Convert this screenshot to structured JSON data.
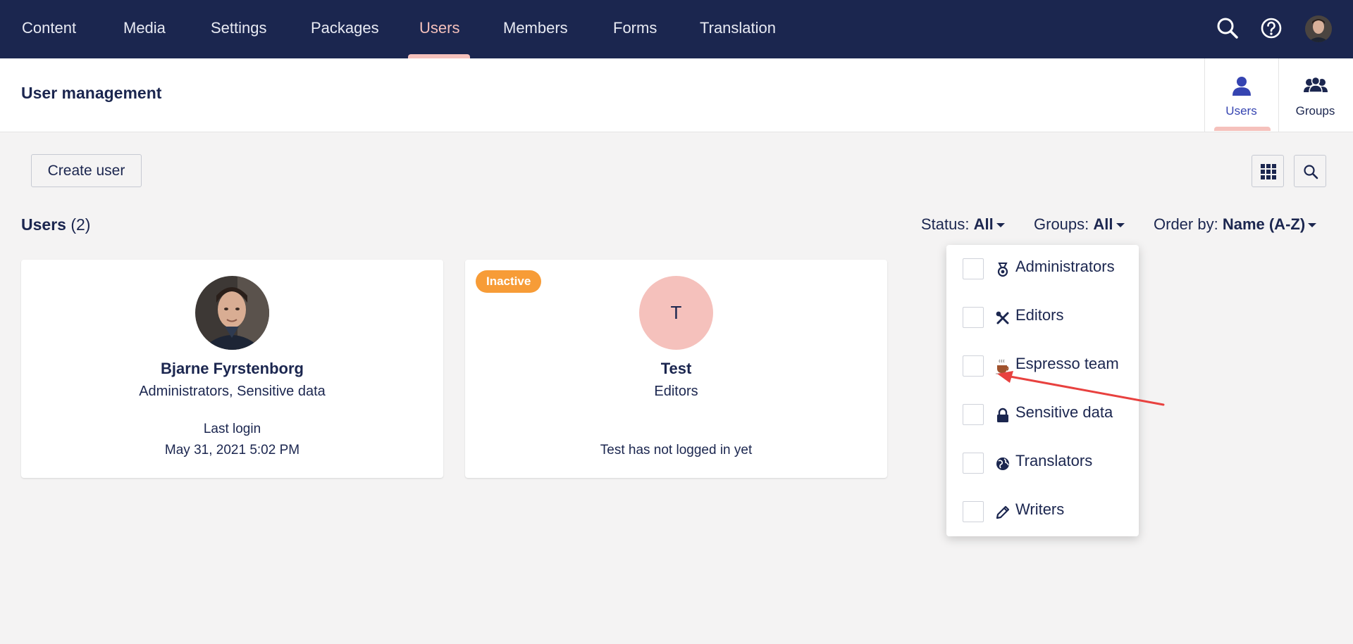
{
  "nav": {
    "items": [
      "Content",
      "Media",
      "Settings",
      "Packages",
      "Users",
      "Members",
      "Forms",
      "Translation"
    ],
    "active": "Users",
    "search_icon": "search-icon",
    "help_icon": "help-icon"
  },
  "header": {
    "title": "User management",
    "apps": [
      {
        "label": "Users",
        "icon": "user-icon",
        "active": true
      },
      {
        "label": "Groups",
        "icon": "groups-icon",
        "active": false
      }
    ]
  },
  "toolbar": {
    "create_label": "Create user",
    "layout_icon": "grid-icon",
    "search_icon": "search-icon"
  },
  "list": {
    "title": "Users",
    "count": "(2)",
    "filters": {
      "status_label": "Status:",
      "status_value": "All",
      "groups_label": "Groups:",
      "groups_value": "All",
      "order_label": "Order by:",
      "order_value": "Name (A-Z)"
    }
  },
  "users": [
    {
      "name": "Bjarne Fyrstenborg",
      "groups": "Administrators, Sensitive data",
      "login_line1": "Last login",
      "login_line2": "May 31, 2021 5:02 PM"
    },
    {
      "badge": "Inactive",
      "initial": "T",
      "name": "Test",
      "groups": "Editors",
      "login_line1": "Test has not logged in yet"
    }
  ],
  "group_filter_options": [
    {
      "label": "Administrators",
      "icon": "medal-icon"
    },
    {
      "label": "Editors",
      "icon": "tools-icon"
    },
    {
      "label": "Espresso team",
      "icon": "coffee-icon"
    },
    {
      "label": "Sensitive data",
      "icon": "lock-icon"
    },
    {
      "label": "Translators",
      "icon": "globe-icon"
    },
    {
      "label": "Writers",
      "icon": "pencil-icon"
    }
  ],
  "colors": {
    "nav_bg": "#1b264f",
    "accent": "#f5c1bc",
    "inactive_badge": "#f79c37",
    "annotation_arrow": "#e8413f"
  }
}
